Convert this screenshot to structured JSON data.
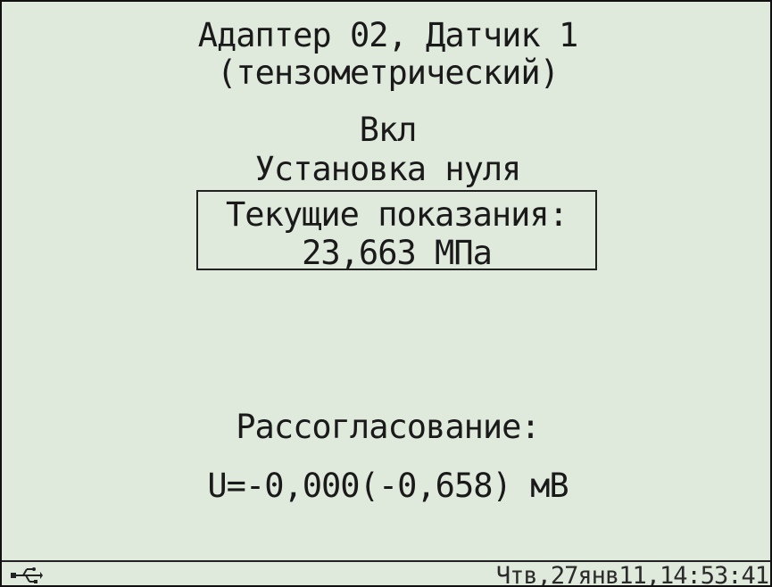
{
  "header": {
    "title_line1": "Адаптер 02, Датчик 1",
    "title_line2": "(тензометрический)"
  },
  "sensor": {
    "state": "Вкл",
    "mode": "Установка нуля"
  },
  "reading": {
    "label": "Текущие показания:",
    "value": "23,663 МПа"
  },
  "mismatch": {
    "label": "Рассогласование:",
    "value": "U=-0,000(-0,658) мВ"
  },
  "status_bar": {
    "usb_icon": "usb-icon",
    "datetime": "Чтв,27янв11,14:53:41"
  }
}
